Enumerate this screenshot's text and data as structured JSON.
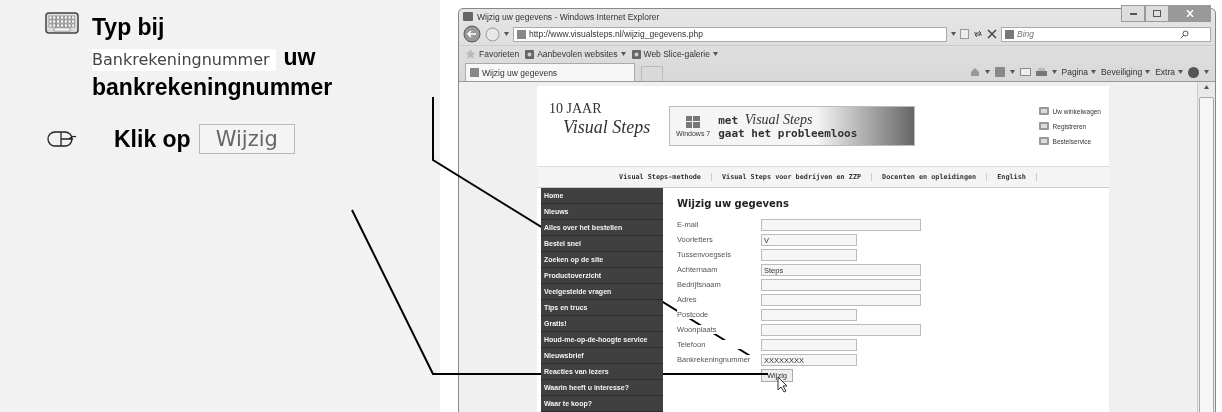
{
  "steps": [
    {
      "kind": "type",
      "text_before": "Typ bij",
      "field_label": "Bankrekeningnummer",
      "text_after_lines": [
        "uw",
        "bankrekeningnummer"
      ]
    },
    {
      "kind": "click",
      "text_before": "Klik op",
      "button_label": "Wijzig"
    }
  ],
  "browser": {
    "title": "Wijzig uw gegevens - Windows Internet Explorer",
    "address": "http://www.visualsteps.nl/wijzig_gegevens.php",
    "search_placeholder": "Bing",
    "favorites": [
      "Favorieten",
      "Aanbevolen websites",
      "Web Slice-galerie"
    ],
    "tab": "Wijzig uw gegevens",
    "commands": [
      "Pagina",
      "Beveiliging",
      "Extra"
    ]
  },
  "page": {
    "logo_top": "10 JAAR",
    "logo_name": "Visual Steps",
    "banner": {
      "badge": "Windows 7",
      "line_1": "met",
      "brand": "Visual Steps",
      "line_2": "gaat het probleemloos"
    },
    "header_links": [
      "Uw winkelwagen",
      "Registreren",
      "Bestelservice"
    ],
    "nav": [
      "Visual Steps-methode",
      "Visual Steps voor bedrijven en ZZP",
      "Docenten en opleidingen",
      "English"
    ],
    "sidebar": [
      "Home",
      "Nieuws",
      "Alles over het bestellen",
      "Bestel snel",
      "Zoeken op de site",
      "Productoverzicht",
      "Veelgestelde vragen",
      "Tips en trucs",
      "Gratis!",
      "Houd-me-op-de-hoogte service",
      "Nieuwsbrief",
      "Reacties van lezers",
      "Waarin heeft u interesse?",
      "Waar te koop?"
    ],
    "form_title": "Wijzig uw gegevens",
    "fields": [
      {
        "label": "E-mail",
        "wide": true
      },
      {
        "label": "Voorletters",
        "value": "V",
        "wide": false
      },
      {
        "label": "Tussenvoegsels",
        "wide": false
      },
      {
        "label": "Achternaam",
        "value": "Steps",
        "wide": true
      },
      {
        "label": "Bedrijfsnaam",
        "wide": true
      },
      {
        "label": "Adres",
        "wide": true
      },
      {
        "label": "Postcode",
        "wide": false
      },
      {
        "label": "Woonplaats",
        "wide": true
      },
      {
        "label": "Telefoon",
        "wide": false
      },
      {
        "label": "Bankrekeningnummer",
        "value": "XXXXXXXX",
        "wide": false
      }
    ],
    "submit": "Wijzig"
  }
}
